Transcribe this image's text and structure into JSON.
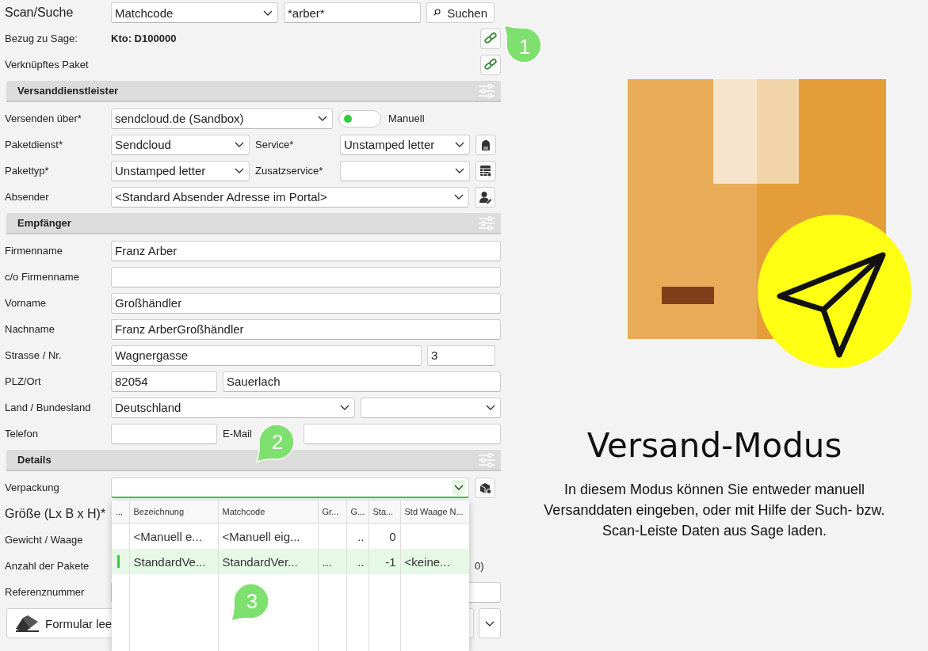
{
  "form": {
    "rows": [
      {
        "kind": "row",
        "label": "Scan/Suche",
        "fields": [
          {
            "kind": "select",
            "value": "Matchcode"
          },
          {
            "kind": "input",
            "value": "*arber*"
          },
          {
            "kind": "button",
            "label": "Suchen"
          }
        ]
      },
      {
        "kind": "row",
        "label": "Bezug zu Sage:",
        "fields": [
          {
            "kind": "text",
            "value": "Kto: D100000"
          },
          {
            "kind": "iconbutton"
          }
        ]
      },
      {
        "kind": "row",
        "label": "Verknüpftes Paket",
        "fields": [
          {
            "kind": "spacer"
          },
          {
            "kind": "iconbutton"
          }
        ]
      },
      {
        "kind": "section",
        "label": "Versanddienstleister"
      },
      {
        "kind": "row",
        "label": "Versenden über*",
        "fields": [
          {
            "kind": "select",
            "value": "sendcloud.de (Sandbox)"
          },
          {
            "kind": "toggle",
            "on": false
          },
          {
            "kind": "label",
            "value": "Manuell"
          }
        ]
      },
      {
        "kind": "row",
        "label": "Paketdienst*",
        "fields": [
          {
            "kind": "select",
            "value": "Sendcloud"
          },
          {
            "kind": "label",
            "value": "Service*"
          },
          {
            "kind": "select",
            "value": "Unstamped letter"
          },
          {
            "kind": "iconbutton"
          }
        ]
      },
      {
        "kind": "row",
        "label": "Pakettyp*",
        "fields": [
          {
            "kind": "select",
            "value": "Unstamped letter"
          },
          {
            "kind": "label",
            "value": "Zusatzservice*"
          },
          {
            "kind": "select"
          },
          {
            "kind": "iconbutton"
          }
        ]
      },
      {
        "kind": "row",
        "label": "Absender",
        "fields": [
          {
            "kind": "select",
            "value": "<Standard Absender Adresse im Portal>"
          },
          {
            "kind": "iconbutton"
          }
        ]
      },
      {
        "kind": "section",
        "label": "Empfänger"
      },
      {
        "kind": "row",
        "label": "Firmenname",
        "fields": [
          {
            "kind": "input",
            "value": "Franz Arber"
          }
        ]
      },
      {
        "kind": "row",
        "label": "c/o Firmenname",
        "fields": [
          {
            "kind": "input"
          }
        ]
      },
      {
        "kind": "row",
        "label": "Vorname",
        "fields": [
          {
            "kind": "input",
            "value": "Großhändler"
          }
        ]
      },
      {
        "kind": "row",
        "label": "Nachname",
        "fields": [
          {
            "kind": "input",
            "value": "Franz ArberGroßhändler"
          }
        ]
      },
      {
        "kind": "row",
        "label": "Strasse / Nr.",
        "fields": [
          {
            "kind": "input",
            "value": "Wagnergasse"
          },
          {
            "kind": "input",
            "value": "3"
          }
        ]
      },
      {
        "kind": "row",
        "label": "PLZ/Ort",
        "fields": [
          {
            "kind": "input",
            "value": "82054"
          },
          {
            "kind": "input",
            "value": "Sauerlach"
          }
        ]
      },
      {
        "kind": "row",
        "label": "Land / Bundesland",
        "fields": [
          {
            "kind": "select",
            "value": "Deutschland"
          },
          {
            "kind": "select"
          }
        ]
      },
      {
        "kind": "row",
        "label": "Telefon",
        "fields": [
          {
            "kind": "input"
          },
          {
            "kind": "label",
            "value": "E-Mail"
          },
          {
            "kind": "input"
          }
        ]
      },
      {
        "kind": "section",
        "label": "Details"
      },
      {
        "kind": "row",
        "label": "Verpackung",
        "fields": [
          {
            "kind": "select",
            "focused": true
          },
          {
            "kind": "iconbutton"
          }
        ]
      },
      {
        "kind": "row",
        "label": "Größe (Lx B x H)*",
        "fields": []
      },
      {
        "kind": "row",
        "label": "Gewicht / Waage",
        "fields": []
      },
      {
        "kind": "row",
        "label": "Anzahl der Pakete",
        "fields": [
          {
            "kind": "spacer"
          },
          {
            "kind": "text",
            "value": "0)"
          }
        ]
      },
      {
        "kind": "row",
        "label": "Referenznummer",
        "fields": [
          {
            "kind": "input"
          }
        ]
      }
    ],
    "footer": {
      "button": "Formular lee"
    }
  },
  "dropdown": {
    "columns": [
      "...",
      "Bezeichnung",
      "Matchcode",
      "Gr...",
      "G...",
      "Sta...",
      "Std Waage N..."
    ],
    "rows": [
      {
        "selected": false,
        "cells": [
          "",
          "<Manuell e...",
          "<Manuell eig...",
          "",
          "..",
          "0",
          ""
        ]
      },
      {
        "selected": true,
        "cells": [
          "",
          "StandardVe...",
          "StandardVer...",
          "...",
          "..",
          "-1",
          "<keine..."
        ]
      }
    ]
  },
  "mode_panel": {
    "title": "Versand-Modus",
    "description": "In diesem Modus können Sie entweder manuell Versanddaten eingeben, oder  mit Hilfe der Such- bzw. Scan-Leiste Daten aus Sage laden."
  },
  "callouts": [
    {
      "label": "1"
    },
    {
      "label": "2"
    },
    {
      "label": "3"
    }
  ]
}
